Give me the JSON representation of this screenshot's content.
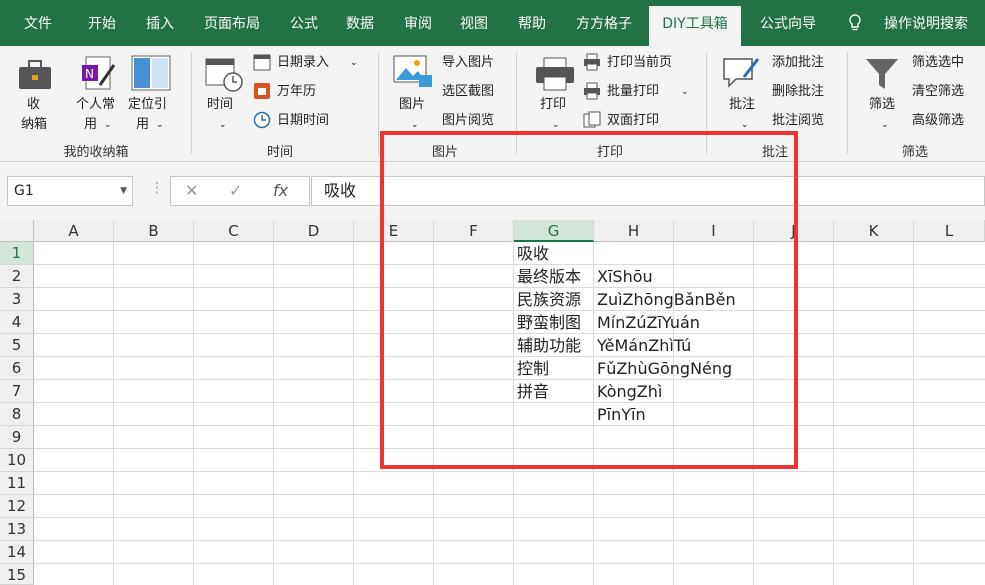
{
  "tabs": [
    {
      "label": "文件"
    },
    {
      "label": "开始"
    },
    {
      "label": "插入"
    },
    {
      "label": "页面布局"
    },
    {
      "label": "公式"
    },
    {
      "label": "数据"
    },
    {
      "label": "审阅"
    },
    {
      "label": "视图"
    },
    {
      "label": "帮助"
    },
    {
      "label": "方方格子"
    },
    {
      "label": "DIY工具箱"
    },
    {
      "label": "公式向导"
    }
  ],
  "search_label": "操作说明搜索",
  "ribbon": {
    "groups": {
      "storage": "我的收纳箱",
      "time": "时间",
      "picture": "图片",
      "print": "打印",
      "comment": "批注",
      "filter": "筛选"
    },
    "storage_box": {
      "line1": "收",
      "line2": "纳箱"
    },
    "personal": {
      "line1": "个人常",
      "line2": "用"
    },
    "locate": {
      "line1": "定位引",
      "line2": "用"
    },
    "time_btn": "时间",
    "date_entry": "日期录入",
    "calendar": "万年历",
    "datetime": "日期时间",
    "picture_btn": "图片",
    "import_pic": "导入图片",
    "screenshot": "选区截图",
    "pic_view": "图片阅览",
    "print_btn": "打印",
    "print_current": "打印当前页",
    "batch_print": "批量打印",
    "duplex_print": "双面打印",
    "comment_btn": "批注",
    "add_comment": "添加批注",
    "del_comment": "删除批注",
    "view_comment": "批注阅览",
    "filter_btn": "筛选",
    "filter_selected": "筛选选中",
    "clear_filter": "清空筛选",
    "adv_filter": "高级筛选"
  },
  "formula_bar": {
    "name_box": "G1",
    "content": "吸收",
    "fx": "fx"
  },
  "columns": [
    "A",
    "B",
    "C",
    "D",
    "E",
    "F",
    "G",
    "H",
    "I",
    "J",
    "K",
    "L"
  ],
  "rows": [
    "1",
    "2",
    "3",
    "4",
    "5",
    "6",
    "7",
    "8",
    "9",
    "10",
    "11",
    "12",
    "13",
    "14",
    "15"
  ],
  "cells_g": [
    "吸收",
    "最终版本",
    "民族资源",
    "野蛮制图",
    "辅助功能",
    "控制",
    "拼音"
  ],
  "cells_h": [
    "XīShōu",
    "ZuìZhōngBǎnBěn",
    "MínZúZīYuán",
    "YěMánZhìTú",
    "FǔZhùGōngNéng",
    "KòngZhì",
    "PīnYīn"
  ],
  "colors": {
    "accent": "#217346",
    "highlight": "#ee3333"
  }
}
